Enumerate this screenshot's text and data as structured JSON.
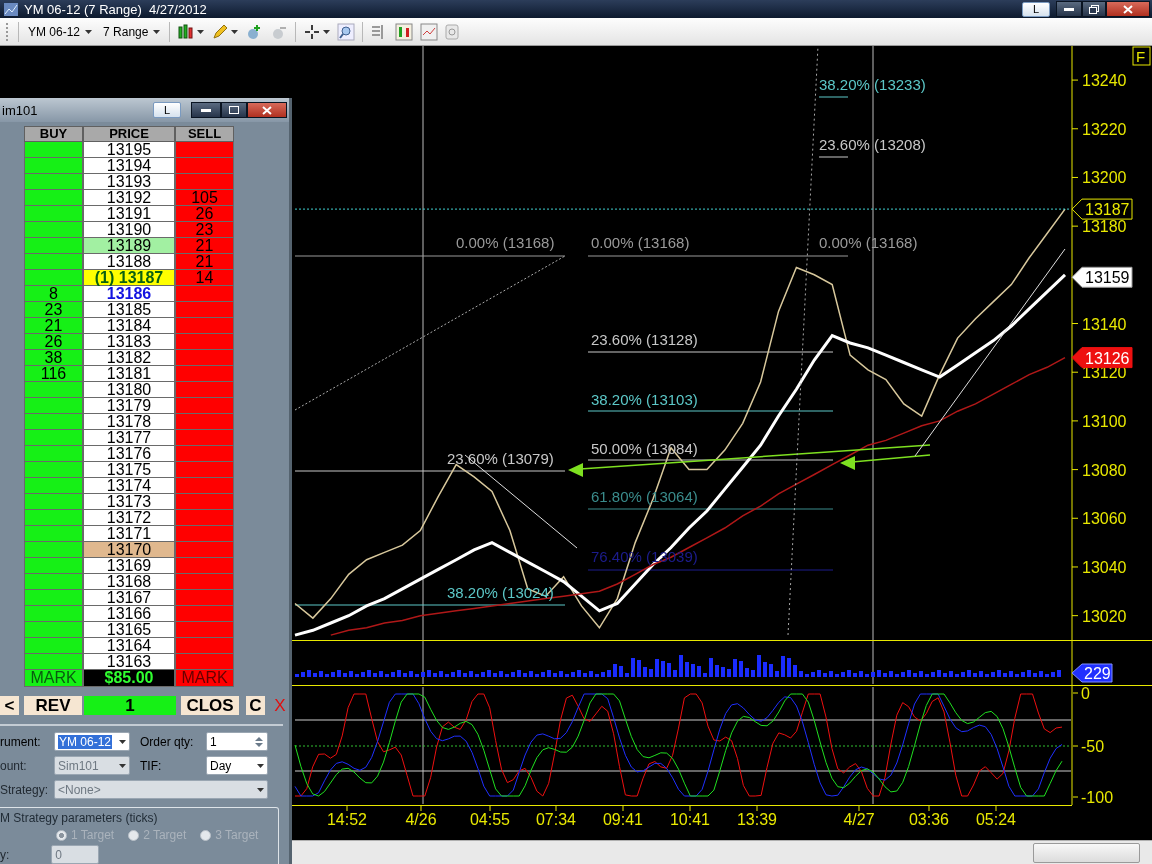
{
  "window": {
    "title": "YM 06-12 (7 Range)  4/27/2012",
    "link_button": "L"
  },
  "toolbar": {
    "items": [
      {
        "kind": "dropdown",
        "label": "YM 06-12"
      },
      {
        "kind": "dropdown",
        "label": "7 Range"
      }
    ]
  },
  "chart": {
    "flag": "F",
    "chart_data": {
      "type": "line",
      "ylim": [
        13010,
        13254
      ],
      "yticks": [
        13240,
        13220,
        13200,
        13180,
        13140,
        13120,
        13100,
        13080,
        13060,
        13040,
        13020
      ],
      "series": [
        {
          "color": "#d8c89c",
          "values": [
            13025,
            13019,
            13027,
            13037,
            13043,
            13046,
            13049,
            13055,
            13069,
            13082,
            13077,
            13071,
            13055,
            13031,
            13028,
            13036,
            13024,
            13015,
            13027,
            13050,
            13068,
            13089,
            13080,
            13080,
            13088,
            13099,
            13116,
            13145,
            13163,
            13160,
            13156,
            13127,
            13121,
            13117,
            13107,
            13102,
            13119,
            13134,
            13142,
            13149,
            13156,
            13167,
            13177,
            13187
          ]
        },
        {
          "color": "#ffffff",
          "values": [
            13012,
            13014,
            13017,
            13020,
            13024,
            13027,
            13031,
            13035,
            13039,
            13043,
            13047,
            13050,
            13046,
            13042,
            13038,
            13034,
            13028,
            13022,
            13025,
            13033,
            13041,
            13048,
            13056,
            13063,
            13072,
            13081,
            13090,
            13102,
            13113,
            13125,
            13135,
            13132,
            13130,
            13127,
            13124,
            13121,
            13118,
            13123,
            13128,
            13133,
            13139,
            13146,
            13153,
            13160
          ]
        },
        {
          "color": "#b01818",
          "values": [
            null,
            null,
            13012,
            13014,
            13015,
            13017,
            13018,
            13020,
            13021,
            13022,
            13023,
            13024,
            13025,
            13026,
            13027,
            13028,
            13029,
            13030,
            13033,
            13037,
            13041,
            13044,
            13048,
            13052,
            13056,
            13061,
            13065,
            13070,
            13074,
            13078,
            13082,
            13086,
            13090,
            13092,
            13095,
            13098,
            13100,
            13104,
            13107,
            13111,
            13115,
            13119,
            13122,
            13126
          ]
        }
      ]
    },
    "fib_levels": [
      {
        "text": "38.20% (13233)",
        "color": "#5cc8c8"
      },
      {
        "text": "23.60% (13208)",
        "color": "#c8c8c8"
      },
      {
        "text": "0.00% (13168)",
        "color": "#9a9a9a"
      },
      {
        "text": "0.00% (13168)",
        "color": "#9a9a9a"
      },
      {
        "text": "0.00% (13168)",
        "color": "#9a9a9a"
      },
      {
        "text": "23.60% (13128)",
        "color": "#c8c8c8"
      },
      {
        "text": "38.20% (13103)",
        "color": "#5cc8c8"
      },
      {
        "text": "50.00% (13084)",
        "color": "#c8c8c8"
      },
      {
        "text": "23.60% (13079)",
        "color": "#c8c8c8"
      },
      {
        "text": "61.80% (13064)",
        "color": "#3a8c8c"
      },
      {
        "text": "76.40% (13039)",
        "color": "#1c1c8c"
      },
      {
        "text": "38.20% (13024)",
        "color": "#5cc8c8"
      }
    ],
    "price_markers": [
      {
        "text": "13187",
        "kind": "last"
      },
      {
        "text": "13159",
        "kind": "fast"
      },
      {
        "text": "13126",
        "kind": "slow"
      }
    ],
    "volume_marker": "229",
    "oscillator_ticks": [
      "0",
      "-50",
      "-100"
    ],
    "time_axis": [
      "14:52",
      "4/26",
      "04:55",
      "07:34",
      "09:41",
      "10:41",
      "13:39",
      "4/27",
      "03:36",
      "05:24"
    ]
  },
  "dom": {
    "title": "im101",
    "link_button": "L",
    "columns": [
      "BUY",
      "PRICE",
      "SELL"
    ],
    "rows": [
      {
        "price": "13195",
        "kind": "normal"
      },
      {
        "price": "13194",
        "kind": "normal"
      },
      {
        "price": "13193",
        "kind": "normal"
      },
      {
        "price": "13192",
        "sell": "105",
        "kind": "normal"
      },
      {
        "price": "13191",
        "sell": "26",
        "kind": "normal"
      },
      {
        "price": "13190",
        "sell": "23",
        "kind": "normal"
      },
      {
        "price": "13189",
        "sell": "21",
        "kind": "inside"
      },
      {
        "price": "13188",
        "sell": "21",
        "kind": "normal"
      },
      {
        "price": "(1) 13187",
        "sell": "14",
        "kind": "last"
      },
      {
        "price": "13186",
        "buy": "8",
        "kind": "current"
      },
      {
        "price": "13185",
        "buy": "23",
        "kind": "normal"
      },
      {
        "price": "13184",
        "buy": "21",
        "kind": "normal"
      },
      {
        "price": "13183",
        "buy": "26",
        "kind": "normal"
      },
      {
        "price": "13182",
        "buy": "38",
        "kind": "normal"
      },
      {
        "price": "13181",
        "buy": "116",
        "kind": "normal"
      },
      {
        "price": "13180",
        "kind": "normal"
      },
      {
        "price": "13179",
        "kind": "normal"
      },
      {
        "price": "13178",
        "kind": "normal"
      },
      {
        "price": "13177",
        "kind": "normal"
      },
      {
        "price": "13176",
        "kind": "normal"
      },
      {
        "price": "13175",
        "kind": "normal"
      },
      {
        "price": "13174",
        "kind": "normal"
      },
      {
        "price": "13173",
        "kind": "normal"
      },
      {
        "price": "13172",
        "kind": "normal"
      },
      {
        "price": "13171",
        "kind": "normal"
      },
      {
        "price": "13170",
        "kind": "level"
      },
      {
        "price": "13169",
        "kind": "normal"
      },
      {
        "price": "13168",
        "kind": "normal"
      },
      {
        "price": "13167",
        "kind": "normal"
      },
      {
        "price": "13166",
        "kind": "normal"
      },
      {
        "price": "13165",
        "kind": "normal"
      },
      {
        "price": "13164",
        "kind": "normal"
      },
      {
        "price": "13163",
        "kind": "normal"
      }
    ],
    "footer": {
      "left": "MARK",
      "pnl": "$85.00",
      "right": "MARK"
    },
    "actions": [
      {
        "label": "<",
        "kind": "nav"
      },
      {
        "label": "REV",
        "kind": "button"
      },
      {
        "label": "1",
        "kind": "qty"
      },
      {
        "label": "CLOS",
        "kind": "button"
      },
      {
        "label": "C",
        "kind": "small"
      },
      {
        "label": "X",
        "kind": "close"
      }
    ],
    "form": {
      "instrument": {
        "label": "rument:",
        "value": "YM 06-12"
      },
      "order_qty": {
        "label": "Order qty:",
        "value": "1"
      },
      "account": {
        "label": "ount:",
        "value": "Sim101",
        "disabled": true
      },
      "tif": {
        "label": "TIF:",
        "value": "Day"
      },
      "strategy": {
        "label": "Strategy:",
        "value": "<None>",
        "disabled": true
      },
      "params": {
        "title": "M Strategy parameters (ticks)",
        "targets": [
          {
            "label": "1 Target",
            "selected": true
          },
          {
            "label": "2 Target",
            "selected": false
          },
          {
            "label": "3 Target",
            "selected": false
          }
        ],
        "field": {
          "label": "y:",
          "value": "0",
          "disabled": true
        }
      }
    }
  }
}
